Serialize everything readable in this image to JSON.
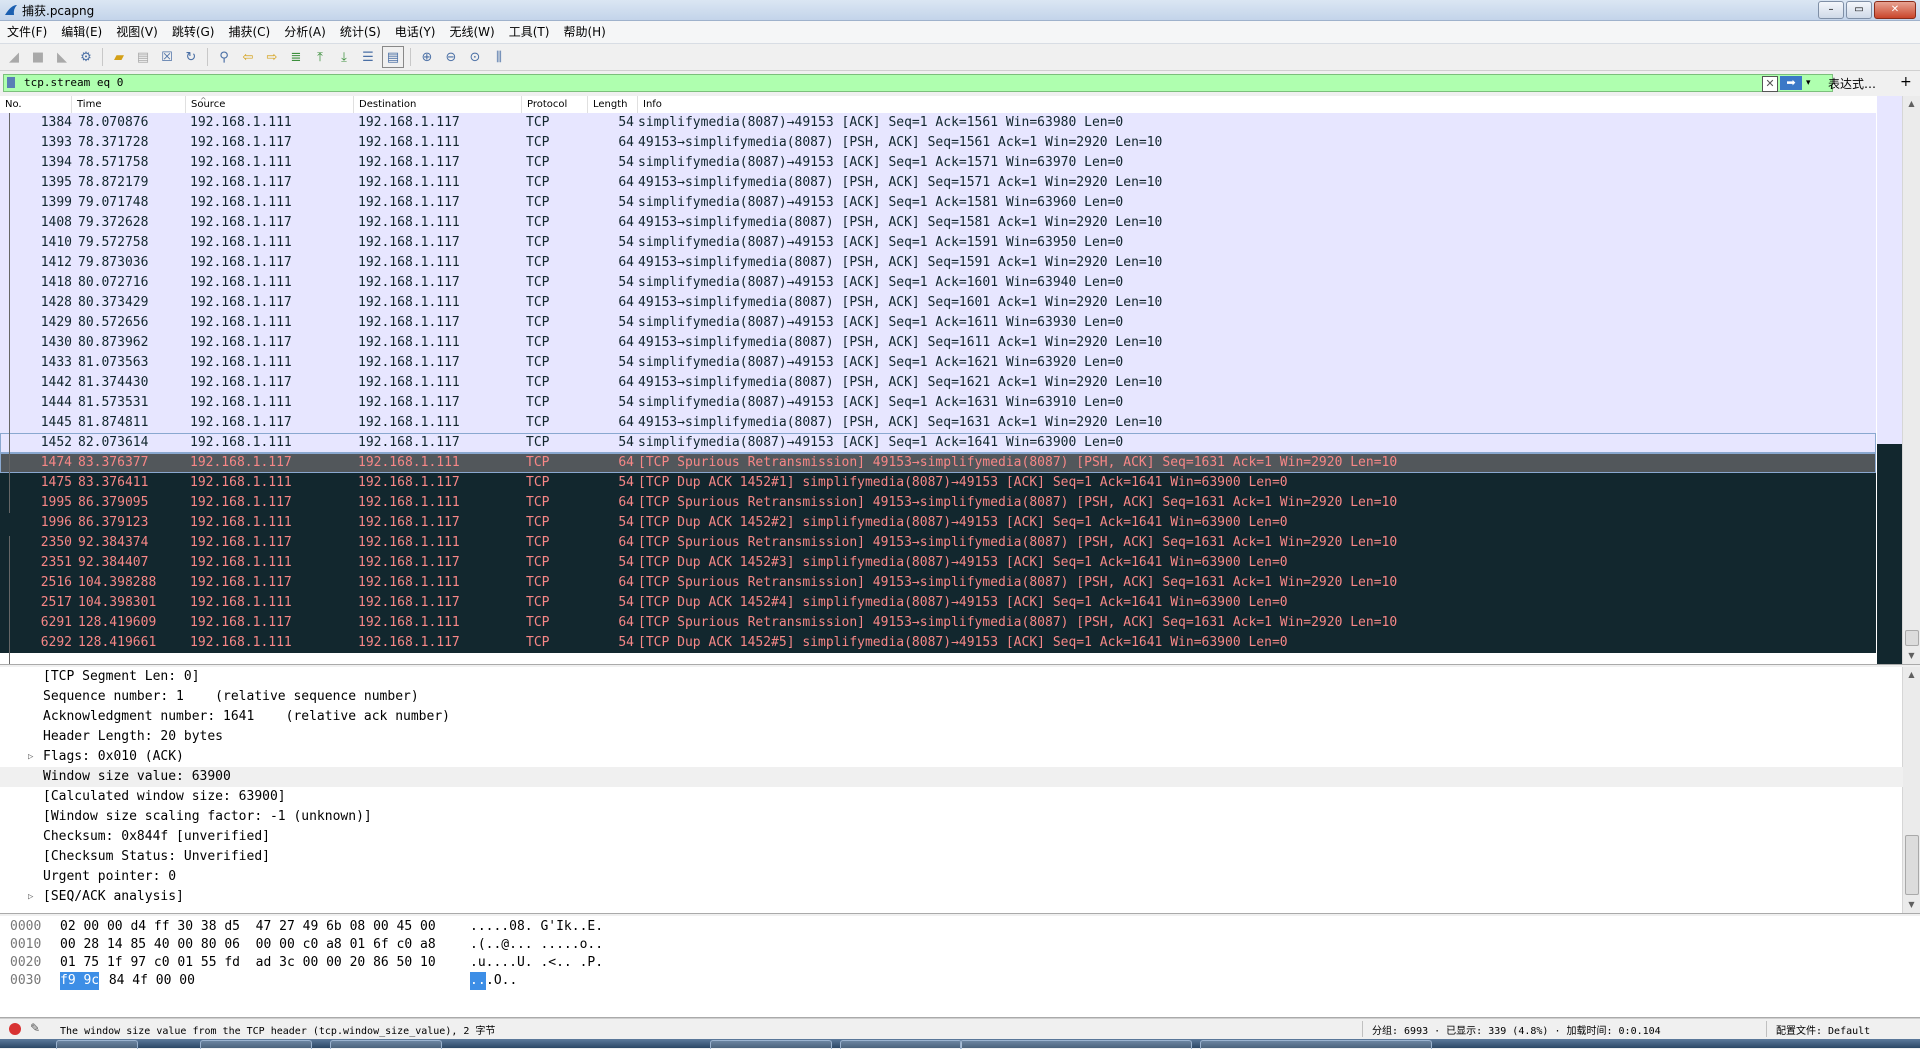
{
  "window": {
    "title": "捕获.pcapng",
    "minimize": "–",
    "maximize": "▭",
    "close": "✕"
  },
  "menu": [
    "文件(F)",
    "编辑(E)",
    "视图(V)",
    "跳转(G)",
    "捕获(C)",
    "分析(A)",
    "统计(S)",
    "电话(Y)",
    "无线(W)",
    "工具(T)",
    "帮助(H)"
  ],
  "toolbar_icons": [
    "shark-fin-start-icon",
    "stop-square-icon",
    "restart-fin-icon",
    "capture-options-gear-icon",
    "open-folder-icon",
    "save-file-icon",
    "close-file-icon",
    "reload-icon",
    "find-magnifier-icon",
    "go-back-arrow-icon",
    "go-forward-arrow-icon",
    "go-to-packet-icon",
    "go-first-icon",
    "go-last-icon",
    "autoscroll-icon",
    "colorize-icon",
    "zoom-in-icon",
    "zoom-out-icon",
    "zoom-reset-icon",
    "resize-columns-icon"
  ],
  "filter": {
    "value": "tcp.stream eq 0",
    "expression_label": "表达式…",
    "add_label": "+"
  },
  "packet_list": {
    "columns": [
      "No.",
      "Time",
      "Source",
      "Destination",
      "Protocol",
      "Length",
      "Info"
    ],
    "rows": [
      {
        "no": "1384",
        "time": "78.070876",
        "src": "192.168.1.111",
        "dst": "192.168.1.117",
        "proto": "TCP",
        "len": "54",
        "info": "simplifymedia(8087)→49153 [ACK] Seq=1 Ack=1561 Win=63980 Len=0",
        "style": "tcp"
      },
      {
        "no": "1393",
        "time": "78.371728",
        "src": "192.168.1.117",
        "dst": "192.168.1.111",
        "proto": "TCP",
        "len": "64",
        "info": "49153→simplifymedia(8087) [PSH, ACK] Seq=1561 Ack=1 Win=2920 Len=10",
        "style": "tcp"
      },
      {
        "no": "1394",
        "time": "78.571758",
        "src": "192.168.1.111",
        "dst": "192.168.1.117",
        "proto": "TCP",
        "len": "54",
        "info": "simplifymedia(8087)→49153 [ACK] Seq=1 Ack=1571 Win=63970 Len=0",
        "style": "tcp"
      },
      {
        "no": "1395",
        "time": "78.872179",
        "src": "192.168.1.117",
        "dst": "192.168.1.111",
        "proto": "TCP",
        "len": "64",
        "info": "49153→simplifymedia(8087) [PSH, ACK] Seq=1571 Ack=1 Win=2920 Len=10",
        "style": "tcp"
      },
      {
        "no": "1399",
        "time": "79.071748",
        "src": "192.168.1.111",
        "dst": "192.168.1.117",
        "proto": "TCP",
        "len": "54",
        "info": "simplifymedia(8087)→49153 [ACK] Seq=1 Ack=1581 Win=63960 Len=0",
        "style": "tcp"
      },
      {
        "no": "1408",
        "time": "79.372628",
        "src": "192.168.1.117",
        "dst": "192.168.1.111",
        "proto": "TCP",
        "len": "64",
        "info": "49153→simplifymedia(8087) [PSH, ACK] Seq=1581 Ack=1 Win=2920 Len=10",
        "style": "tcp"
      },
      {
        "no": "1410",
        "time": "79.572758",
        "src": "192.168.1.111",
        "dst": "192.168.1.117",
        "proto": "TCP",
        "len": "54",
        "info": "simplifymedia(8087)→49153 [ACK] Seq=1 Ack=1591 Win=63950 Len=0",
        "style": "tcp"
      },
      {
        "no": "1412",
        "time": "79.873036",
        "src": "192.168.1.117",
        "dst": "192.168.1.111",
        "proto": "TCP",
        "len": "64",
        "info": "49153→simplifymedia(8087) [PSH, ACK] Seq=1591 Ack=1 Win=2920 Len=10",
        "style": "tcp"
      },
      {
        "no": "1418",
        "time": "80.072716",
        "src": "192.168.1.111",
        "dst": "192.168.1.117",
        "proto": "TCP",
        "len": "54",
        "info": "simplifymedia(8087)→49153 [ACK] Seq=1 Ack=1601 Win=63940 Len=0",
        "style": "tcp"
      },
      {
        "no": "1428",
        "time": "80.373429",
        "src": "192.168.1.117",
        "dst": "192.168.1.111",
        "proto": "TCP",
        "len": "64",
        "info": "49153→simplifymedia(8087) [PSH, ACK] Seq=1601 Ack=1 Win=2920 Len=10",
        "style": "tcp"
      },
      {
        "no": "1429",
        "time": "80.572656",
        "src": "192.168.1.111",
        "dst": "192.168.1.117",
        "proto": "TCP",
        "len": "54",
        "info": "simplifymedia(8087)→49153 [ACK] Seq=1 Ack=1611 Win=63930 Len=0",
        "style": "tcp"
      },
      {
        "no": "1430",
        "time": "80.873962",
        "src": "192.168.1.117",
        "dst": "192.168.1.111",
        "proto": "TCP",
        "len": "64",
        "info": "49153→simplifymedia(8087) [PSH, ACK] Seq=1611 Ack=1 Win=2920 Len=10",
        "style": "tcp"
      },
      {
        "no": "1433",
        "time": "81.073563",
        "src": "192.168.1.111",
        "dst": "192.168.1.117",
        "proto": "TCP",
        "len": "54",
        "info": "simplifymedia(8087)→49153 [ACK] Seq=1 Ack=1621 Win=63920 Len=0",
        "style": "tcp"
      },
      {
        "no": "1442",
        "time": "81.374430",
        "src": "192.168.1.117",
        "dst": "192.168.1.111",
        "proto": "TCP",
        "len": "64",
        "info": "49153→simplifymedia(8087) [PSH, ACK] Seq=1621 Ack=1 Win=2920 Len=10",
        "style": "tcp"
      },
      {
        "no": "1444",
        "time": "81.573531",
        "src": "192.168.1.111",
        "dst": "192.168.1.117",
        "proto": "TCP",
        "len": "54",
        "info": "simplifymedia(8087)→49153 [ACK] Seq=1 Ack=1631 Win=63910 Len=0",
        "style": "tcp"
      },
      {
        "no": "1445",
        "time": "81.874811",
        "src": "192.168.1.117",
        "dst": "192.168.1.111",
        "proto": "TCP",
        "len": "64",
        "info": "49153→simplifymedia(8087) [PSH, ACK] Seq=1631 Ack=1 Win=2920 Len=10",
        "style": "tcp"
      },
      {
        "no": "1452",
        "time": "82.073614",
        "src": "192.168.1.111",
        "dst": "192.168.1.117",
        "proto": "TCP",
        "len": "54",
        "info": "simplifymedia(8087)→49153 [ACK] Seq=1 Ack=1641 Win=63900 Len=0",
        "style": "sel"
      },
      {
        "no": "1474",
        "time": "83.376377",
        "src": "192.168.1.117",
        "dst": "192.168.1.111",
        "proto": "TCP",
        "len": "64",
        "info": "[TCP Spurious Retransmission] 49153→simplifymedia(8087) [PSH, ACK] Seq=1631 Ack=1 Win=2920 Len=10",
        "style": "hl"
      },
      {
        "no": "1475",
        "time": "83.376411",
        "src": "192.168.1.111",
        "dst": "192.168.1.117",
        "proto": "TCP",
        "len": "54",
        "info": "[TCP Dup ACK 1452#1] simplifymedia(8087)→49153 [ACK] Seq=1 Ack=1641 Win=63900 Len=0",
        "style": "bad"
      },
      {
        "no": "1995",
        "time": "86.379095",
        "src": "192.168.1.117",
        "dst": "192.168.1.111",
        "proto": "TCP",
        "len": "64",
        "info": "[TCP Spurious Retransmission] 49153→simplifymedia(8087) [PSH, ACK] Seq=1631 Ack=1 Win=2920 Len=10",
        "style": "bad"
      },
      {
        "no": "1996",
        "time": "86.379123",
        "src": "192.168.1.111",
        "dst": "192.168.1.117",
        "proto": "TCP",
        "len": "54",
        "info": "[TCP Dup ACK 1452#2] simplifymedia(8087)→49153 [ACK] Seq=1 Ack=1641 Win=63900 Len=0",
        "style": "bad"
      },
      {
        "no": "2350",
        "time": "92.384374",
        "src": "192.168.1.117",
        "dst": "192.168.1.111",
        "proto": "TCP",
        "len": "64",
        "info": "[TCP Spurious Retransmission] 49153→simplifymedia(8087) [PSH, ACK] Seq=1631 Ack=1 Win=2920 Len=10",
        "style": "bad"
      },
      {
        "no": "2351",
        "time": "92.384407",
        "src": "192.168.1.111",
        "dst": "192.168.1.117",
        "proto": "TCP",
        "len": "54",
        "info": "[TCP Dup ACK 1452#3] simplifymedia(8087)→49153 [ACK] Seq=1 Ack=1641 Win=63900 Len=0",
        "style": "bad"
      },
      {
        "no": "2516",
        "time": "104.398288",
        "src": "192.168.1.117",
        "dst": "192.168.1.111",
        "proto": "TCP",
        "len": "64",
        "info": "[TCP Spurious Retransmission] 49153→simplifymedia(8087) [PSH, ACK] Seq=1631 Ack=1 Win=2920 Len=10",
        "style": "bad"
      },
      {
        "no": "2517",
        "time": "104.398301",
        "src": "192.168.1.111",
        "dst": "192.168.1.117",
        "proto": "TCP",
        "len": "54",
        "info": "[TCP Dup ACK 1452#4] simplifymedia(8087)→49153 [ACK] Seq=1 Ack=1641 Win=63900 Len=0",
        "style": "bad"
      },
      {
        "no": "6291",
        "time": "128.419609",
        "src": "192.168.1.117",
        "dst": "192.168.1.111",
        "proto": "TCP",
        "len": "64",
        "info": "[TCP Spurious Retransmission] 49153→simplifymedia(8087) [PSH, ACK] Seq=1631 Ack=1 Win=2920 Len=10",
        "style": "bad"
      },
      {
        "no": "6292",
        "time": "128.419661",
        "src": "192.168.1.111",
        "dst": "192.168.1.117",
        "proto": "TCP",
        "len": "54",
        "info": "[TCP Dup ACK 1452#5] simplifymedia(8087)→49153 [ACK] Seq=1 Ack=1641 Win=63900 Len=0",
        "style": "bad"
      }
    ]
  },
  "details": [
    {
      "text": "[TCP Segment Len: 0]"
    },
    {
      "text": "Sequence number: 1    (relative sequence number)"
    },
    {
      "text": "Acknowledgment number: 1641    (relative ack number)"
    },
    {
      "text": "Header Length: 20 bytes"
    },
    {
      "text": "Flags: 0x010 (ACK)",
      "expander": "▷"
    },
    {
      "text": "Window size value: 63900",
      "selected": true
    },
    {
      "text": "[Calculated window size: 63900]"
    },
    {
      "text": "[Window size scaling factor: -1 (unknown)]"
    },
    {
      "text": "Checksum: 0x844f [unverified]"
    },
    {
      "text": "[Checksum Status: Unverified]"
    },
    {
      "text": "Urgent pointer: 0"
    },
    {
      "text": "[SEQ/ACK analysis]",
      "expander": "▷"
    }
  ],
  "bytes": [
    {
      "offset": "0000",
      "hex": "02 00 00 d4 ff 30 38 d5  47 27 49 6b 08 00 45 00",
      "ascii": ".....08. G'Ik..E."
    },
    {
      "offset": "0010",
      "hex": "00 28 14 85 40 00 80 06  00 00 c0 a8 01 6f c0 a8",
      "ascii": ".(..@... .....o.."
    },
    {
      "offset": "0020",
      "hex": "01 75 1f 97 c0 01 55 fd  ad 3c 00 00 20 86 50 10",
      "ascii": ".u....U. .<.. .P."
    },
    {
      "offset": "0030",
      "hex_selected": "f9 9c",
      "hex_rest": " 84 4f 00 00",
      "ascii_selected": "..",
      "ascii_rest": ".O.."
    }
  ],
  "status": {
    "message": "The window size value from the TCP header (tcp.window_size_value), 2 字节",
    "stats": "分组: 6993 · 已显示: 339 (4.8%) · 加载时间: 0:0.104",
    "profile": "配置文件: Default"
  }
}
